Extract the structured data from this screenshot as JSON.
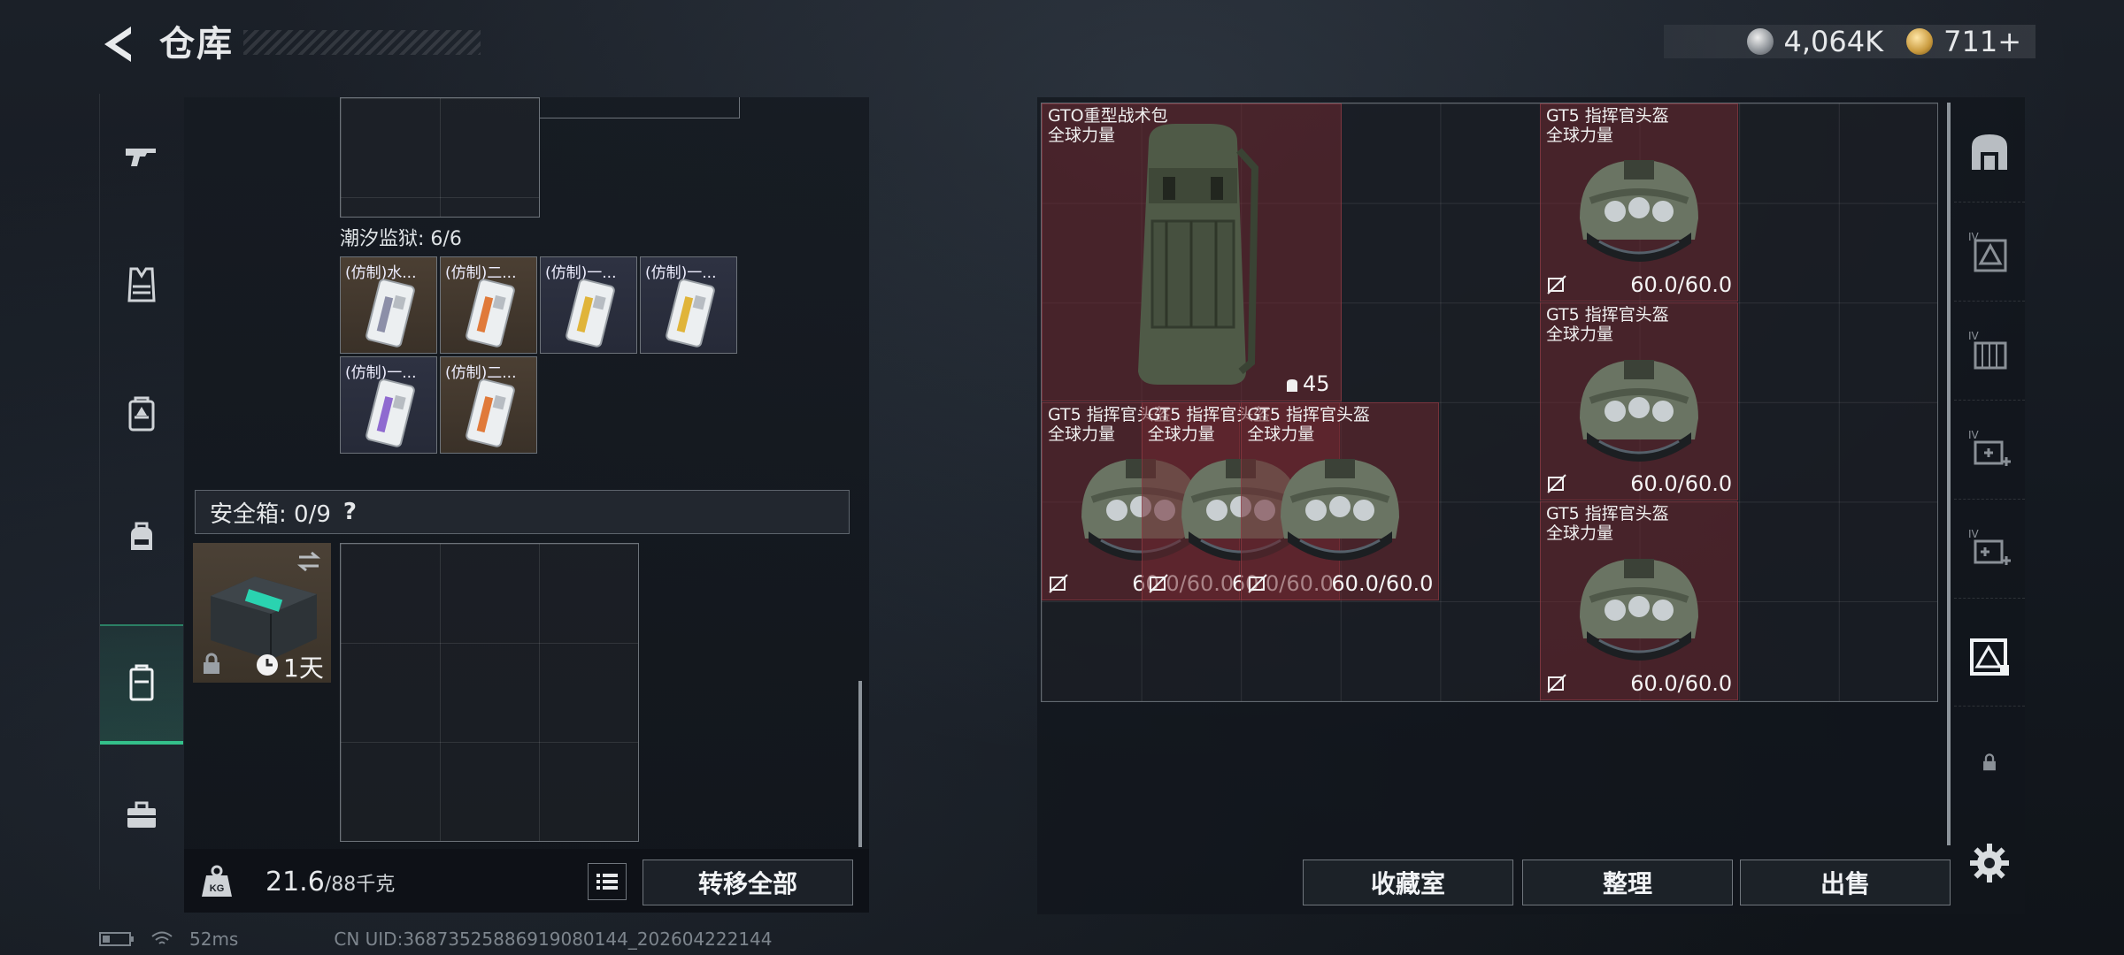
{
  "header": {
    "title": "仓库",
    "currency": {
      "silver": "4,064K",
      "gold": "711+"
    }
  },
  "sidebar": {
    "items": [
      {
        "icon": "gun-icon"
      },
      {
        "icon": "vest-icon"
      },
      {
        "icon": "backpack-icon"
      },
      {
        "icon": "pouch-icon"
      },
      {
        "icon": "safe-box-icon",
        "active": true
      },
      {
        "icon": "toolbox-icon"
      }
    ]
  },
  "left_panel": {
    "prison_label": "潮汐监狱: 6/6",
    "prison_cards": [
      {
        "name": "(仿制)水...",
        "tint": "brown",
        "stripe": "#8c8fa8"
      },
      {
        "name": "(仿制)二...",
        "tint": "brown",
        "stripe": "#e07a3a"
      },
      {
        "name": "(仿制)一...",
        "tint": "navy",
        "stripe": "#e0b43a"
      },
      {
        "name": "(仿制)一...",
        "tint": "navy",
        "stripe": "#e0b43a"
      },
      {
        "name": "(仿制)一...",
        "tint": "navy",
        "stripe": "#8f6ad0"
      },
      {
        "name": "(仿制)二...",
        "tint": "brown",
        "stripe": "#e07a3a"
      }
    ],
    "safe_box": {
      "label": "安全箱: 0/9",
      "help": "?",
      "timer": "1天"
    }
  },
  "bottom_bar": {
    "weight_value": "21.6",
    "weight_max": "/88千克",
    "transfer_all": "转移全部"
  },
  "status": {
    "ping": "52ms",
    "uid": "CN UID:3687352588691908014​4_202604222144"
  },
  "stash": {
    "backpack": {
      "name": "GTO重型战术包",
      "sub": "全球力量",
      "capacity": "45"
    },
    "helmets": [
      {
        "name": "GT5 指挥官头盔",
        "sub": "全球力量",
        "durability": "60.0/60.0"
      },
      {
        "name": "GT5 指挥官头盔",
        "sub": "全球力量",
        "durability": "60.0/60.0"
      },
      {
        "name": "GT5 指挥官头盔",
        "sub": "全球力量",
        "durability": "60.0/60.0"
      },
      {
        "name": "GT5 指挥官头盔",
        "sub": "全球力量",
        "durability": "60.0/60.0"
      },
      {
        "name": "GT5 指挥官头盔",
        "sub": "全球力量",
        "durability": "60.0/60.0"
      },
      {
        "name": "GT5 指挥官头盔",
        "sub": "全球力量",
        "durability": "60.0/60.0"
      }
    ]
  },
  "actions": {
    "collection": "收藏室",
    "organize": "整理",
    "sell": "出售"
  },
  "right_sidebar": {
    "items": [
      {
        "icon": "stash-home-icon"
      },
      {
        "icon": "stash-tab-iv-a-icon",
        "tier": "IV"
      },
      {
        "icon": "stash-tab-iv-b-icon",
        "tier": "IV"
      },
      {
        "icon": "stash-tab-iv-c-icon",
        "tier": "IV"
      },
      {
        "icon": "stash-tab-iv-d-icon",
        "tier": "IV"
      },
      {
        "icon": "stash-tab-active-icon",
        "active": true
      },
      {
        "icon": "lock-icon"
      },
      {
        "icon": "settings-icon"
      }
    ]
  },
  "colors": {
    "accent": "#34c08a",
    "item_bg": "#6e2830",
    "panel_bg": "#161b22"
  }
}
